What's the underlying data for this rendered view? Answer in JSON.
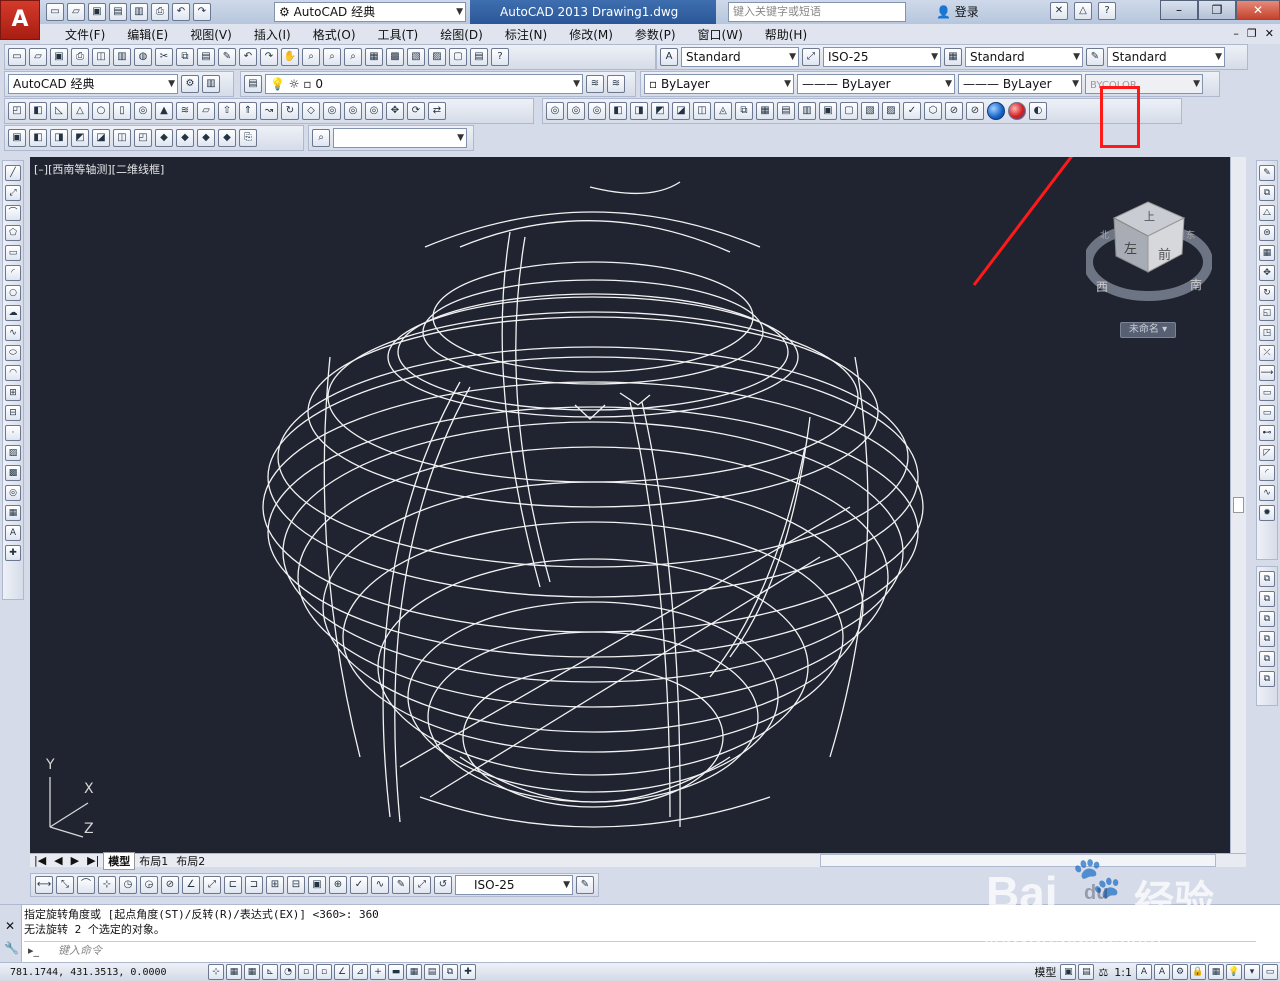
{
  "app": {
    "logo_letter": "A",
    "workspace": "AutoCAD 经典",
    "window_title": "AutoCAD 2013    Drawing1.dwg",
    "search_placeholder": "键入关键字或短语",
    "login": "登录"
  },
  "menu": [
    "文件(F)",
    "编辑(E)",
    "视图(V)",
    "插入(I)",
    "格式(O)",
    "工具(T)",
    "绘图(D)",
    "标注(N)",
    "修改(M)",
    "参数(P)",
    "窗口(W)",
    "帮助(H)"
  ],
  "styles": {
    "text_style": "Standard",
    "dim_style": "ISO-25",
    "table_style": "Standard",
    "multileader_style": "Standard"
  },
  "layers": {
    "workspace": "AutoCAD 经典",
    "current_layer": "0",
    "color": "ByLayer",
    "linetype": "ByLayer",
    "lineweight": "ByLayer",
    "plotstyle": "BYCOLOR"
  },
  "viewport": {
    "label": "[–][西南等轴测][二维线框]",
    "ucs_x": "X",
    "ucs_y": "Y",
    "ucs_z": "Z",
    "viewcube_top": "上",
    "viewcube_left": "左",
    "viewcube_front": "前",
    "compass_w": "西",
    "compass_s": "南",
    "compass_n": "北",
    "compass_e": "东",
    "ucs_name": "未命名"
  },
  "tabs": [
    "模型",
    "布局1",
    "布局2"
  ],
  "dim_toolbar": {
    "dim_style": "ISO-25"
  },
  "command": {
    "history": [
      "指定旋转角度或 [起点角度(ST)/反转(R)/表达式(EX)] <360>: 360",
      "无法旋转 2 个选定的对象。"
    ],
    "input_placeholder": "键入命令"
  },
  "status": {
    "coords": "781.1744,  431.3513, 0.0000",
    "space": "模型",
    "scale": "1:1"
  },
  "watermark": {
    "brand": "Bai",
    "paw": "du",
    "cn": "经验",
    "url": "jingyan.baidu.com"
  },
  "colors": {
    "canvas": "#1f2430",
    "highlight": "#ff1a1a",
    "accent": "#2a5698"
  }
}
